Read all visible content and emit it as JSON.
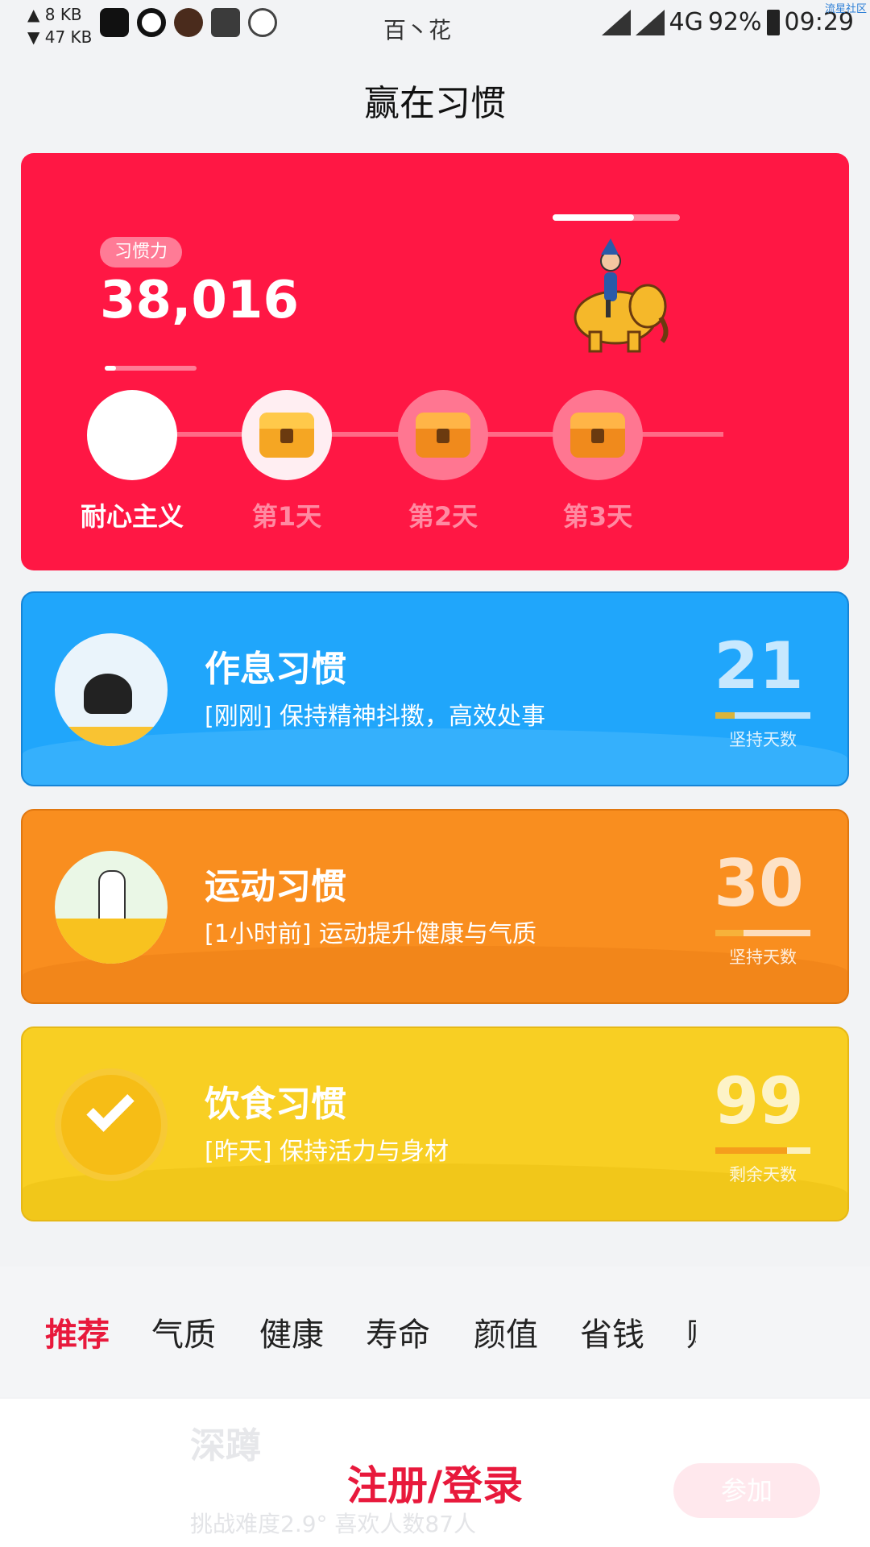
{
  "status_bar": {
    "net_up": "▲ 8 KB",
    "net_down": "▼ 47 KB",
    "carrier": "百丶花",
    "network": "4G",
    "battery": "92%",
    "time": "09:29",
    "watermark": "流星社区"
  },
  "header": {
    "title": "赢在习惯"
  },
  "hero": {
    "badge": "习惯力",
    "score": "38,016",
    "mini_progress": 0.12,
    "top_progress": 0.64,
    "milestones": [
      {
        "label": "耐心主义",
        "state": "done",
        "icon": "blank-circle-icon"
      },
      {
        "label": "第1天",
        "state": "chest",
        "icon": "treasure-chest-icon"
      },
      {
        "label": "第2天",
        "state": "locked",
        "icon": "locked-chest-icon"
      },
      {
        "label": "第3天",
        "state": "locked",
        "icon": "locked-chest-icon"
      }
    ]
  },
  "habits": [
    {
      "title": "作息习惯",
      "subtitle": "[刚刚] 保持精神抖擞，高效处事",
      "number": "21",
      "caption": "坚持天数",
      "progress": 0.2,
      "color": "#20a6fb",
      "icon": "sleeping-girl-icon"
    },
    {
      "title": "运动习惯",
      "subtitle": "[1小时前] 运动提升健康与气质",
      "number": "30",
      "caption": "坚持天数",
      "progress": 0.3,
      "color": "#f98e1f",
      "icon": "exercising-person-icon"
    },
    {
      "title": "饮食习惯",
      "subtitle": "[昨天] 保持活力与身材",
      "number": "99",
      "caption": "剩余天数",
      "progress": 0.75,
      "color": "#f8cf23",
      "icon": "no-food-check-icon"
    }
  ],
  "tabs": [
    {
      "label": "推荐",
      "active": true
    },
    {
      "label": "气质",
      "active": false
    },
    {
      "label": "健康",
      "active": false
    },
    {
      "label": "寿命",
      "active": false
    },
    {
      "label": "颜值",
      "active": false
    },
    {
      "label": "省钱",
      "active": false
    },
    {
      "label": "财",
      "active": false
    }
  ],
  "bottom_sheet": {
    "ghost_title": "深蹲",
    "ghost_subtitle": "挑战难度2.9° 喜欢人数87人",
    "ghost_button": "参加",
    "login_label": "注册/登录"
  },
  "colors": {
    "hero_red": "#ff1744",
    "accent_red": "#e8193c",
    "blue": "#20a6fb",
    "orange": "#f98e1f",
    "yellow": "#f8cf23"
  }
}
